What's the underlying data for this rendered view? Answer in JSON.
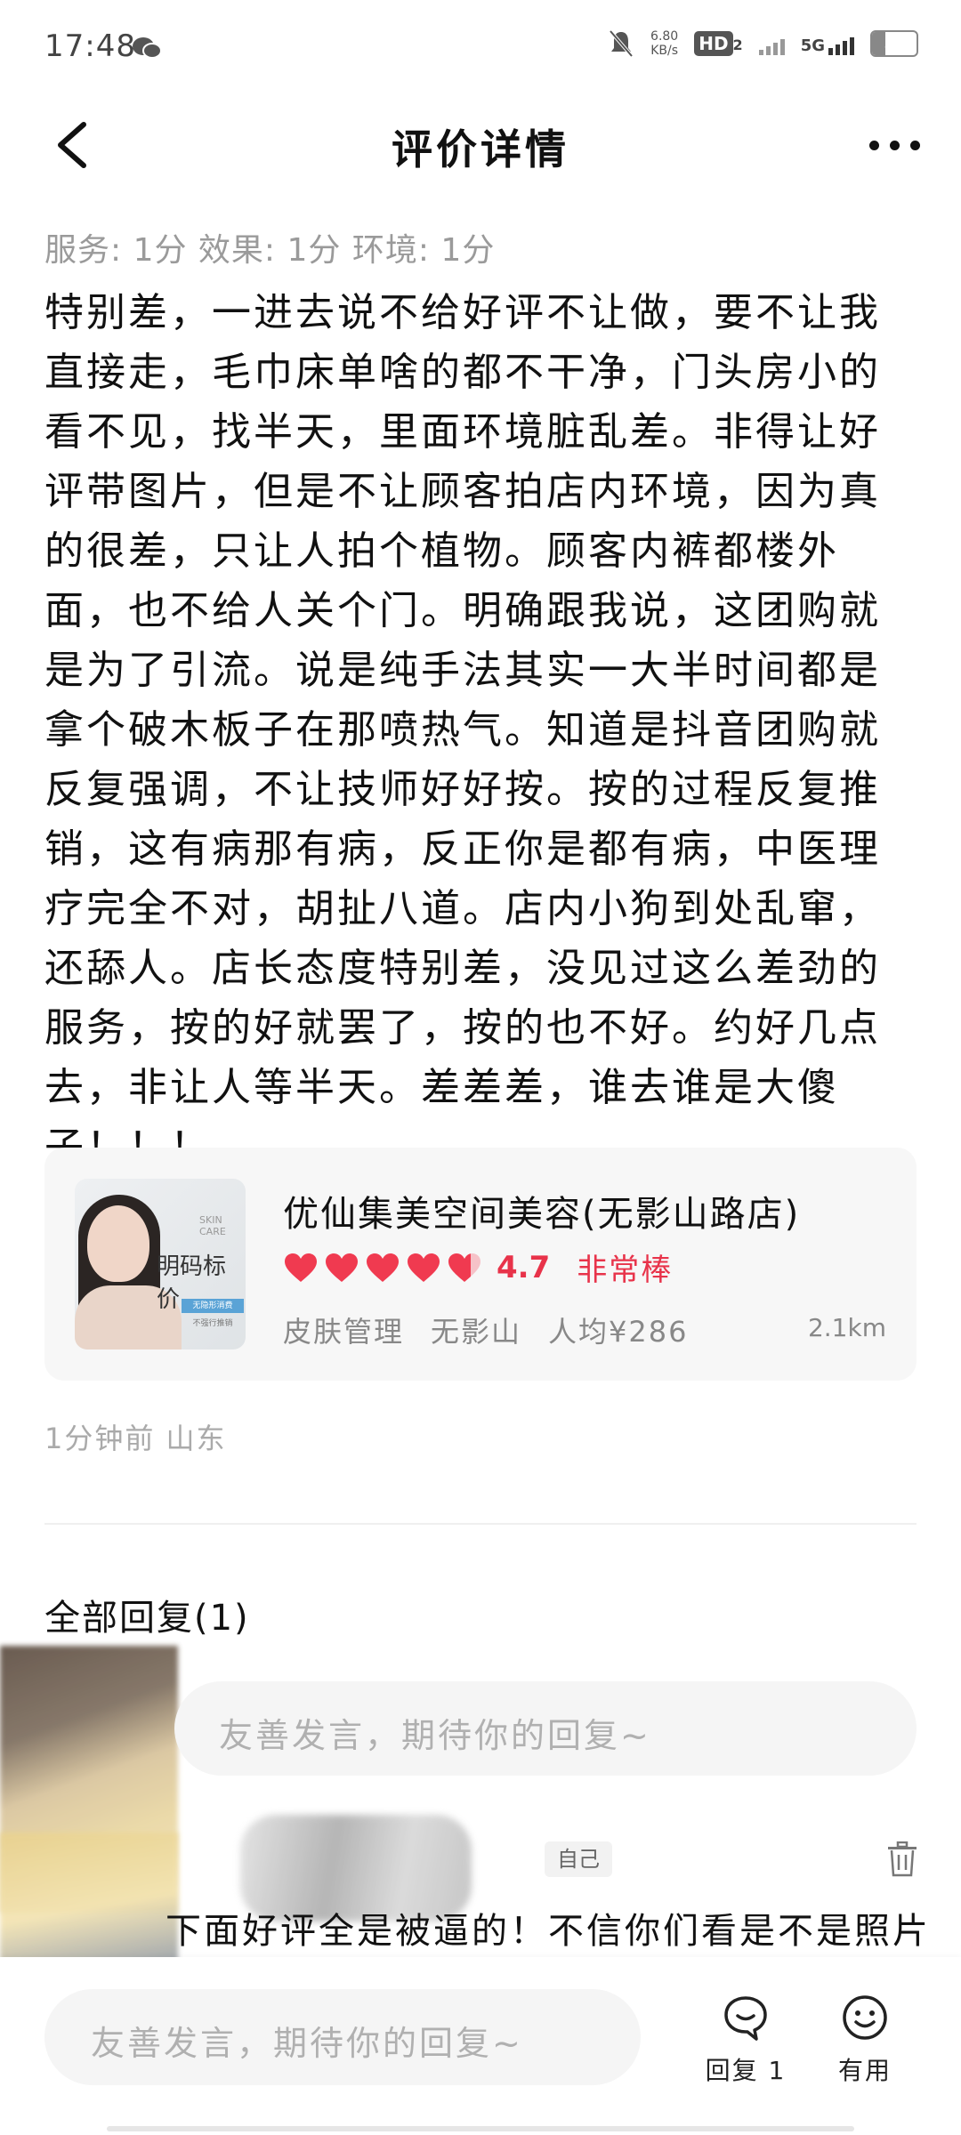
{
  "status_bar": {
    "time": "17:48",
    "net_speed_value": "6.80",
    "net_speed_unit": "KB/s",
    "hd_label": "HD",
    "hd_sub": "2",
    "network": "5G",
    "battery": "30"
  },
  "nav": {
    "title": "评价详情"
  },
  "review": {
    "scores": "服务: 1分 效果: 1分 环境: 1分",
    "text": "特别差，一进去说不给好评不让做，要不让我直接走，毛巾床单啥的都不干净，门头房小的看不见，找半天，里面环境脏乱差。非得让好评带图片，但是不让顾客拍店内环境，因为真的很差，只让人拍个植物。顾客内裤都楼外面，也不给人关个门。明确跟我说，这团购就是为了引流。说是纯手法其实一大半时间都是拿个破木板子在那喷热气。知道是抖音团购就反复强调，不让技师好好按。按的过程反复推销，这有病那有病，反正你是都有病，中医理疗完全不对，胡扯八道。店内小狗到处乱窜，还舔人。店长态度特别差，没见过这么差劲的服务，按的好就罢了，按的也不好。约好几点去，非让人等半天。差差差，谁去谁是大傻子！！！"
  },
  "shop": {
    "name": "优仙集美空间美容(无影山路店)",
    "rating": "4.7",
    "rating_value": 4.7,
    "rating_text": "非常棒",
    "category": "皮肤管理",
    "area": "无影山",
    "avg_price": "人均¥286",
    "distance": "2.1km",
    "thumb_text": "明码标价",
    "thumb_en": "SKIN CARE",
    "thumb_tag1": "无隐形消费",
    "thumb_tag2": "不强行推销"
  },
  "post_meta": "1分钟前  山东",
  "replies": {
    "header": "全部回复(1)",
    "input_placeholder": "友善发言，期待你的回复~",
    "items": [
      {
        "badge": "自己",
        "text": "下面好评全是被逼的！不信你们看是不是照片"
      }
    ]
  },
  "bottom_bar": {
    "input_placeholder": "友善发言，期待你的回复~",
    "reply_label": "回复 1",
    "useful_label": "有用"
  },
  "colors": {
    "accent": "#e8334a",
    "muted_text": "#9a9a9a",
    "card_bg": "#f7f7f7"
  }
}
